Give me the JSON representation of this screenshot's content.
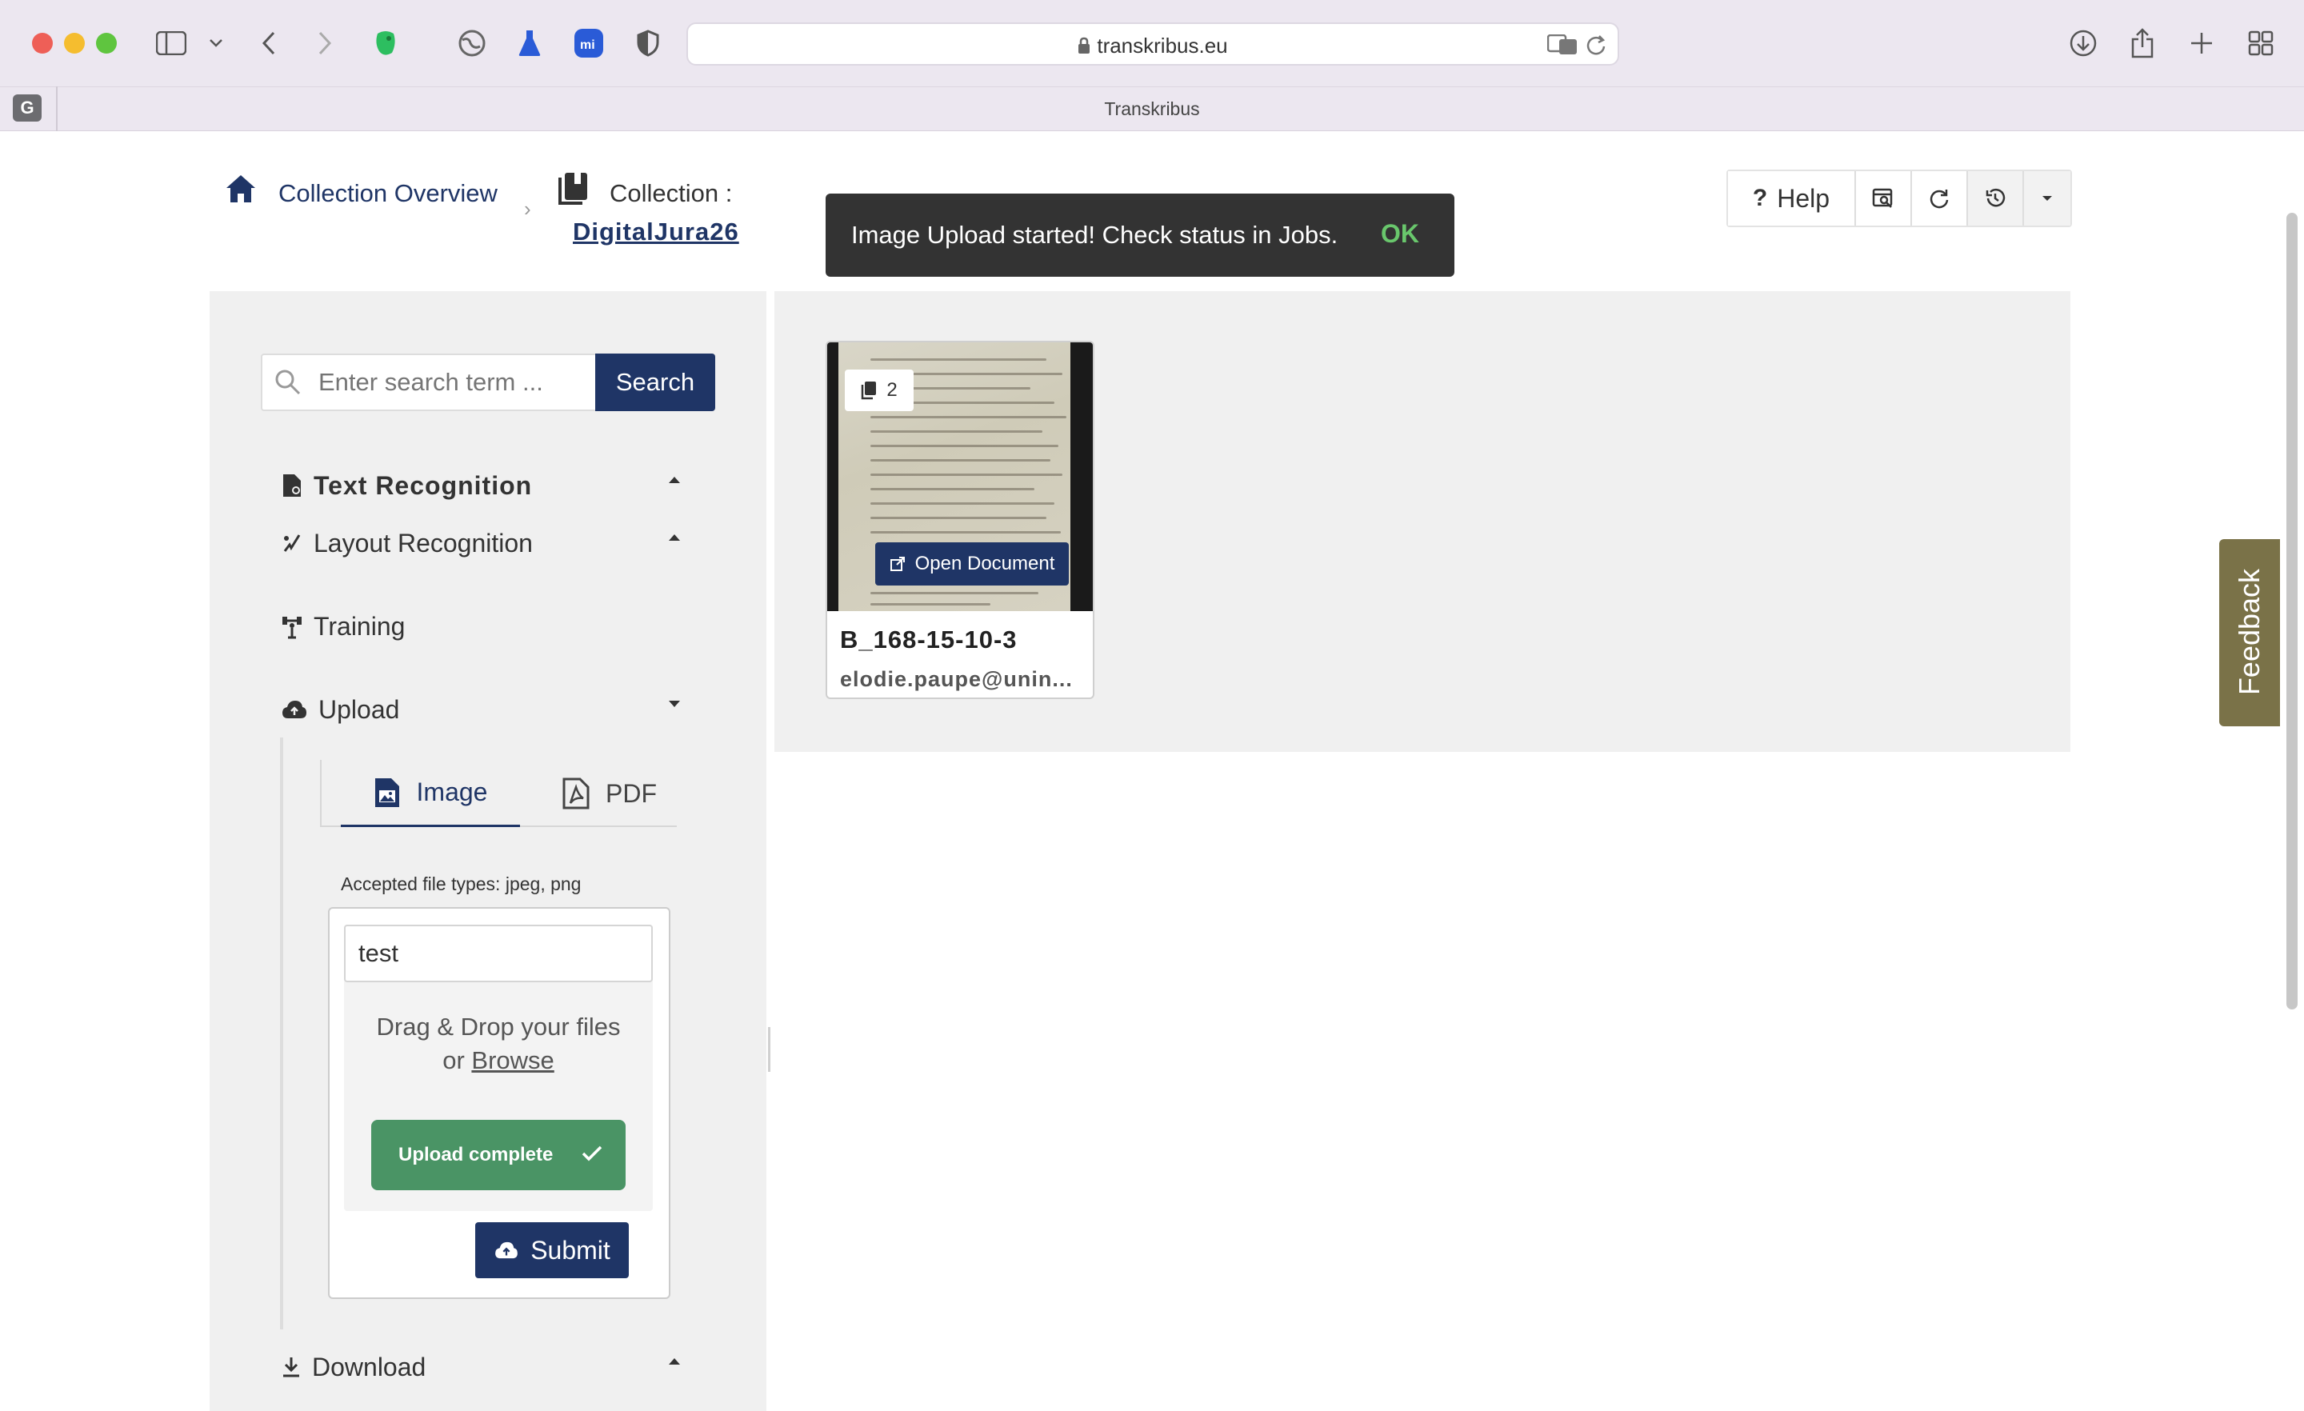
{
  "browser": {
    "url": "transkribus.eu",
    "tab_title": "Transkribus",
    "tab_group_badge": "G"
  },
  "breadcrumb": {
    "home_label": "Collection Overview",
    "collection_prefix": "Collection :",
    "collection_name": "DigitalJura26"
  },
  "toast": {
    "message": "Image Upload started! Check status in Jobs.",
    "action": "OK"
  },
  "toolbar": {
    "help_label": "Help"
  },
  "sidebar": {
    "search_placeholder": "Enter search term ...",
    "search_button": "Search",
    "menu": {
      "text_recognition": "Text Recognition",
      "layout_recognition": "Layout Recognition",
      "training": "Training",
      "upload": "Upload",
      "download": "Download"
    },
    "upload": {
      "tab_image": "Image",
      "tab_pdf": "PDF",
      "accepted_types": "Accepted file types: jpeg, png",
      "name_value": "test",
      "drag_drop": "Drag & Drop your files",
      "or": "or",
      "browse": "Browse",
      "status": "Upload complete",
      "submit": "Submit"
    }
  },
  "documents": [
    {
      "title": "B_168-15-10-3",
      "owner": "elodie.paupe@unin...",
      "page_count": "2",
      "open_label": "Open Document"
    }
  ],
  "feedback_label": "Feedback",
  "colors": {
    "primary": "#1f3566",
    "success": "#4a9465",
    "toast_bg": "#333333",
    "toast_ok": "#69c76c",
    "feedback": "#7a7248"
  }
}
